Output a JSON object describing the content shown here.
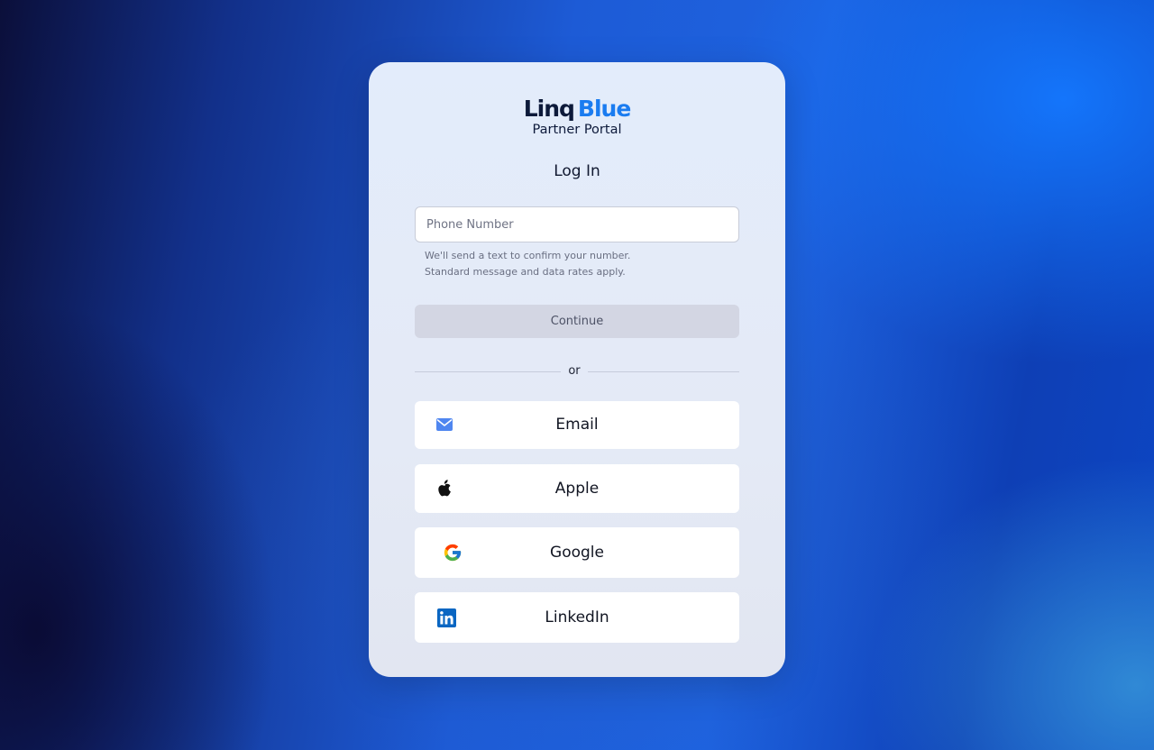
{
  "brand": {
    "name_part1": "Linq",
    "name_part2": "Blue",
    "subtitle": "Partner Portal",
    "dark_color": "#0d1a3a",
    "accent_color": "#1a7cf0"
  },
  "login": {
    "title": "Log In",
    "phone": {
      "placeholder": "Phone Number",
      "value": ""
    },
    "helper_line1": "We'll send a text to confirm your number.",
    "helper_line2": "Standard message and data rates apply.",
    "continue_label": "Continue",
    "divider_label": "or"
  },
  "social": [
    {
      "label": "Email",
      "icon": "envelope-icon"
    },
    {
      "label": "Apple",
      "icon": "apple-icon"
    },
    {
      "label": "Google",
      "icon": "google-icon"
    },
    {
      "label": "LinkedIn",
      "icon": "linkedin-icon"
    }
  ]
}
